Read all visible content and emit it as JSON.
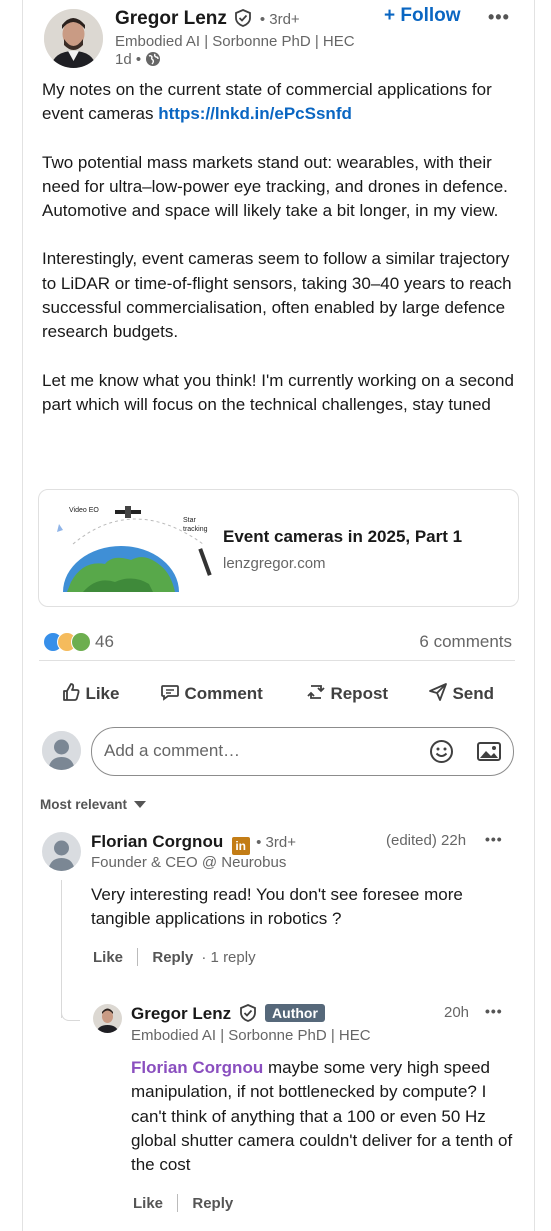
{
  "post": {
    "author": {
      "name": "Gregor Lenz",
      "degree": "• 3rd+",
      "headline": "Embodied AI | Sorbonne PhD | HEC",
      "time": "1d •"
    },
    "follow_label": "+ Follow",
    "more_label": "•••",
    "text": {
      "p1": "My notes on the current state of commercial applications for event cameras ",
      "p1_link": "https://lnkd.in/ePcSsnfd",
      "p2": "Two potential mass markets stand out: wearables, with their need for ultra–low-power eye tracking, and drones in defence. Automotive and space will likely take a bit longer, in my view.",
      "p3": "Interestingly, event cameras seem to follow a similar trajectory to LiDAR or time-of-flight sensors, taking 30–40 years to reach successful commercialisation, often enabled by large defence research budgets.",
      "p4": "Let me know what you think! I'm currently working on a second part which will focus on the technical challenges, stay tuned"
    },
    "link_preview": {
      "title": "Event cameras in 2025, Part 1",
      "domain": "lenzgregor.com",
      "thumb_label_1": "Video EO",
      "thumb_label_2": "Star",
      "thumb_label_3": "tracking"
    },
    "reactions_count": "46",
    "comments_count": "6 comments",
    "actions": {
      "like": "Like",
      "comment": "Comment",
      "repost": "Repost",
      "send": "Send"
    },
    "comment_input_placeholder": "Add a comment…",
    "sort_label": "Most relevant"
  },
  "comments": [
    {
      "name": "Florian Corgnou",
      "degree": "• 3rd+",
      "headline": "Founder & CEO @ Neurobus",
      "meta": "(edited) 22h",
      "text": "Very interesting read! You don't see foresee more tangible applications in robotics ?",
      "like": "Like",
      "reply": "Reply",
      "replies": "· 1 reply"
    }
  ],
  "reply": {
    "name": "Gregor Lenz",
    "badge": "Author",
    "headline": "Embodied AI | Sorbonne PhD | HEC",
    "time": "20h",
    "mention": "Florian Corgnou",
    "text": " maybe some very high speed manipulation, if not bottlenecked by compute? I can't think of anything that a 100 or even 50 Hz global shutter camera couldn't deliver for a tenth of the cost",
    "like": "Like",
    "reply_label": "Reply"
  },
  "colors": {
    "accent": "#0a66c2",
    "mention": "#8a4fbf",
    "author_badge": "#56687a"
  }
}
